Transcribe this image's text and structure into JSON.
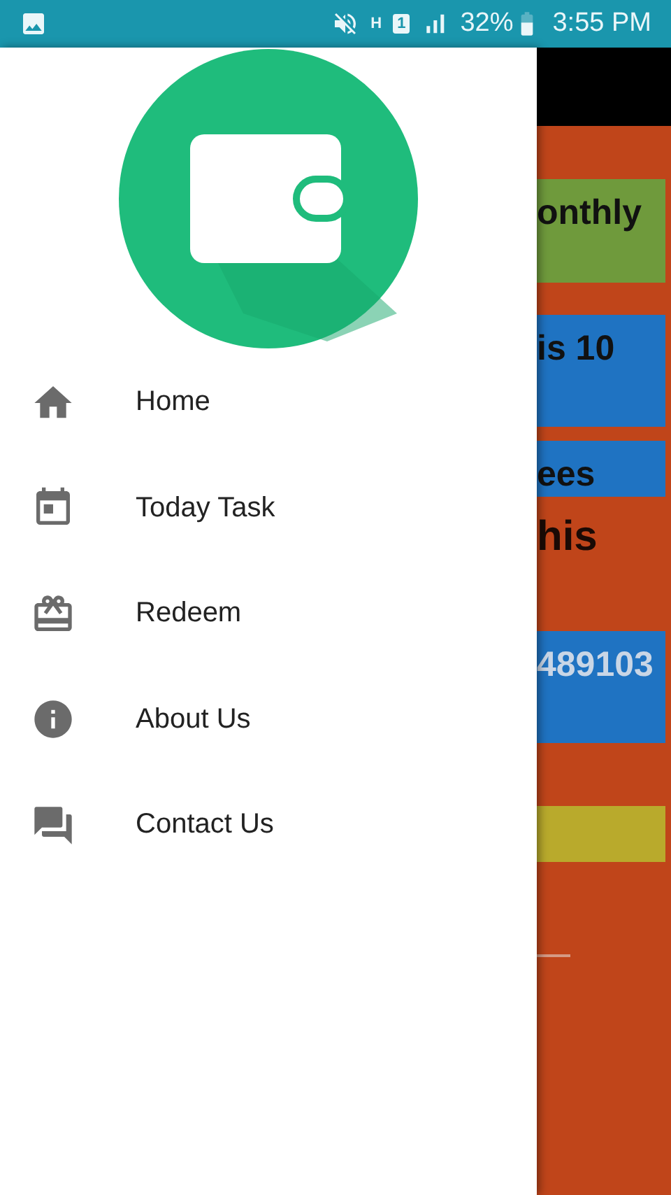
{
  "status_bar": {
    "network": "H",
    "sim": "1",
    "battery": "32%",
    "time": "3:55 PM"
  },
  "drawer": {
    "items": [
      {
        "label": "Home"
      },
      {
        "label": "Today Task"
      },
      {
        "label": "Redeem"
      },
      {
        "label": "About Us"
      },
      {
        "label": "Contact Us"
      }
    ]
  },
  "background_screen": {
    "blocks": [
      {
        "kind": "toolbar"
      },
      {
        "kind": "card",
        "color": "#6f9a3c",
        "text": "onthly",
        "inverse": false
      },
      {
        "kind": "card",
        "color": "#1f73c2",
        "text": "is 10",
        "inverse": false
      },
      {
        "kind": "card",
        "color": "#1f73c2",
        "text": "ees",
        "inverse": false
      },
      {
        "kind": "text",
        "text": "his"
      },
      {
        "kind": "card",
        "color": "#1f73c2",
        "text": "489103",
        "inverse": true
      },
      {
        "kind": "card",
        "color": "#b9aa2c"
      },
      {
        "kind": "rule"
      }
    ]
  }
}
